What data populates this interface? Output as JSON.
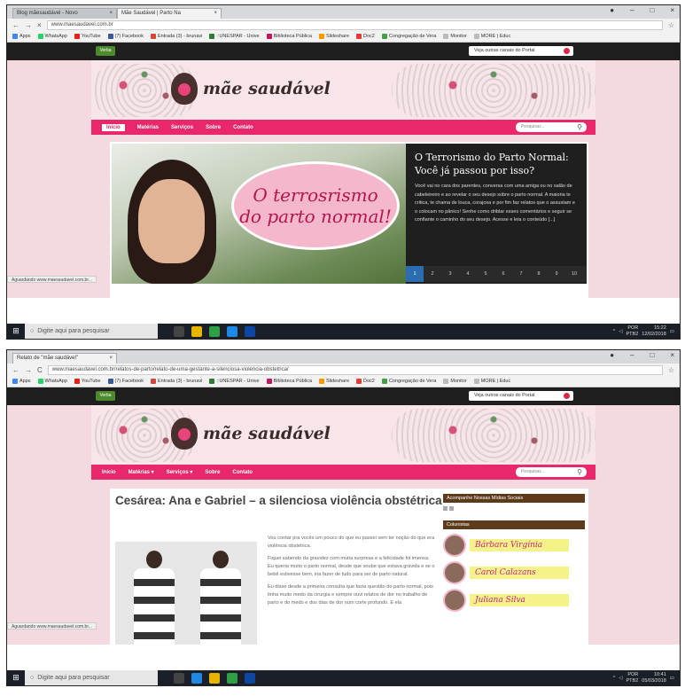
{
  "shot1": {
    "tabs": [
      "Blog mãesaudável - Novo",
      "Mãe Saudável | Parto Na"
    ],
    "url": "www.maesaudavel.com.br",
    "bookmarks": [
      "Apps",
      "WhatsApp",
      "YouTube",
      "(7) Facebook",
      "Entrada (3) - brunavi",
      "::UNESPAR - Unive",
      "Biblioteca Pública",
      "Slideshare",
      "Doc2",
      "Congregação de Vera",
      "Monitor",
      "MORE | Educ"
    ],
    "site_badge": "Verba",
    "social_button": "Veja outras canais do Portal",
    "brand": "mãe saudável",
    "nav": [
      "Início",
      "Matérias",
      "Serviços",
      "Sobre",
      "Contato"
    ],
    "search_placeholder": "Pesquisar...",
    "bubble_lines": [
      "O terrosrismo",
      "do parto normal!"
    ],
    "slide_title": "O Terrorismo do Parto Normal: Você já passou por isso?",
    "slide_body": "Você vai no cara dos parentes, conversa com uma amiga ou no salão de cabeleireiro e ao revelar o seu desejo sobre o parto normal. A maioria te critica, te chama de louca, corajosa e por fim faz relatos que o assustam e o colocam no pânico! Senhe como driblar esses comentários e seguir se confiante o caminho do seu desejo. Acesse e leia o conteúdo [...]",
    "pages": [
      "1",
      "2",
      "3",
      "4",
      "5",
      "6",
      "7",
      "8",
      "9",
      "10"
    ],
    "status": "Aguardando www.maesaudavel.com.br...",
    "taskbar_search": "Digite aqui para pesquisar",
    "tray_lang": "POR",
    "tray_time": "15:22",
    "tray_layout": "PTB2",
    "tray_date": "12/02/2018"
  },
  "shot2": {
    "tabs": [
      "Relato de \"mãe saudável\""
    ],
    "url": "www.maesaudavel.com.br/relatos-de-parto/relato-de-uma-gestante-a-silenciosa-violencia-obstetrica/",
    "bookmarks": [
      "Apps",
      "WhatsApp",
      "YouTube",
      "(7) Facebook",
      "Entrada (3) - brunavi",
      "::UNESPAR - Unive",
      "Biblioteca Pública",
      "Slideshare",
      "Doc2",
      "Congregação de Vera",
      "Monitor",
      "MORE | Educ"
    ],
    "site_badge": "Verba",
    "social_button": "Veja outros canais do Portal",
    "brand": "mãe saudável",
    "nav": [
      "Início",
      "Matérias ▾",
      "Serviços ▾",
      "Sobre",
      "Contato"
    ],
    "search_placeholder": "Pesquisar...",
    "article_title": "Cesárea: Ana e Gabriel – a silenciosa violência obstétrica",
    "paragraphs": [
      "Vou contar pra vocês um pouco do que eu passei sem ter noção do que era violência obstétrica.",
      "Fiquei sabendo da gravidez com muita surpresa e a felicidade foi imensa. Eu queria muito o parto normal, desde que soube que estava grávida e se o bebê estivesse bem, iria fazer de tudo para ser de parto natural.",
      "Eu disse desde a primeira consulta que fazia questão do parto normal, pois tinha muito medo da cirurgia e sempre ouvi relatos de dor no trabalho de parto e do medo e dos dias de dor num corte profundo. E ela"
    ],
    "sidebar_heading1": "Acompanhe Nossas Mídias Sociais",
    "sidebar_heading2": "Colunistas",
    "columnists": [
      "Bárbara Virgínia",
      "Carol Calazans",
      "Juliana Silva"
    ],
    "status": "Aguardando www.maesaudavel.com.br...",
    "taskbar_search": "Digite aqui para pesquisar",
    "tray_lang": "POR",
    "tray_time": "10:41",
    "tray_layout": "PTB2",
    "tray_date": "05/03/2018"
  },
  "colors": {
    "nav_pink": "#e8286a",
    "header_bg": "#f8e5ea",
    "slide_dark": "#1f1f1f",
    "column_yellow": "#f6f28a"
  }
}
